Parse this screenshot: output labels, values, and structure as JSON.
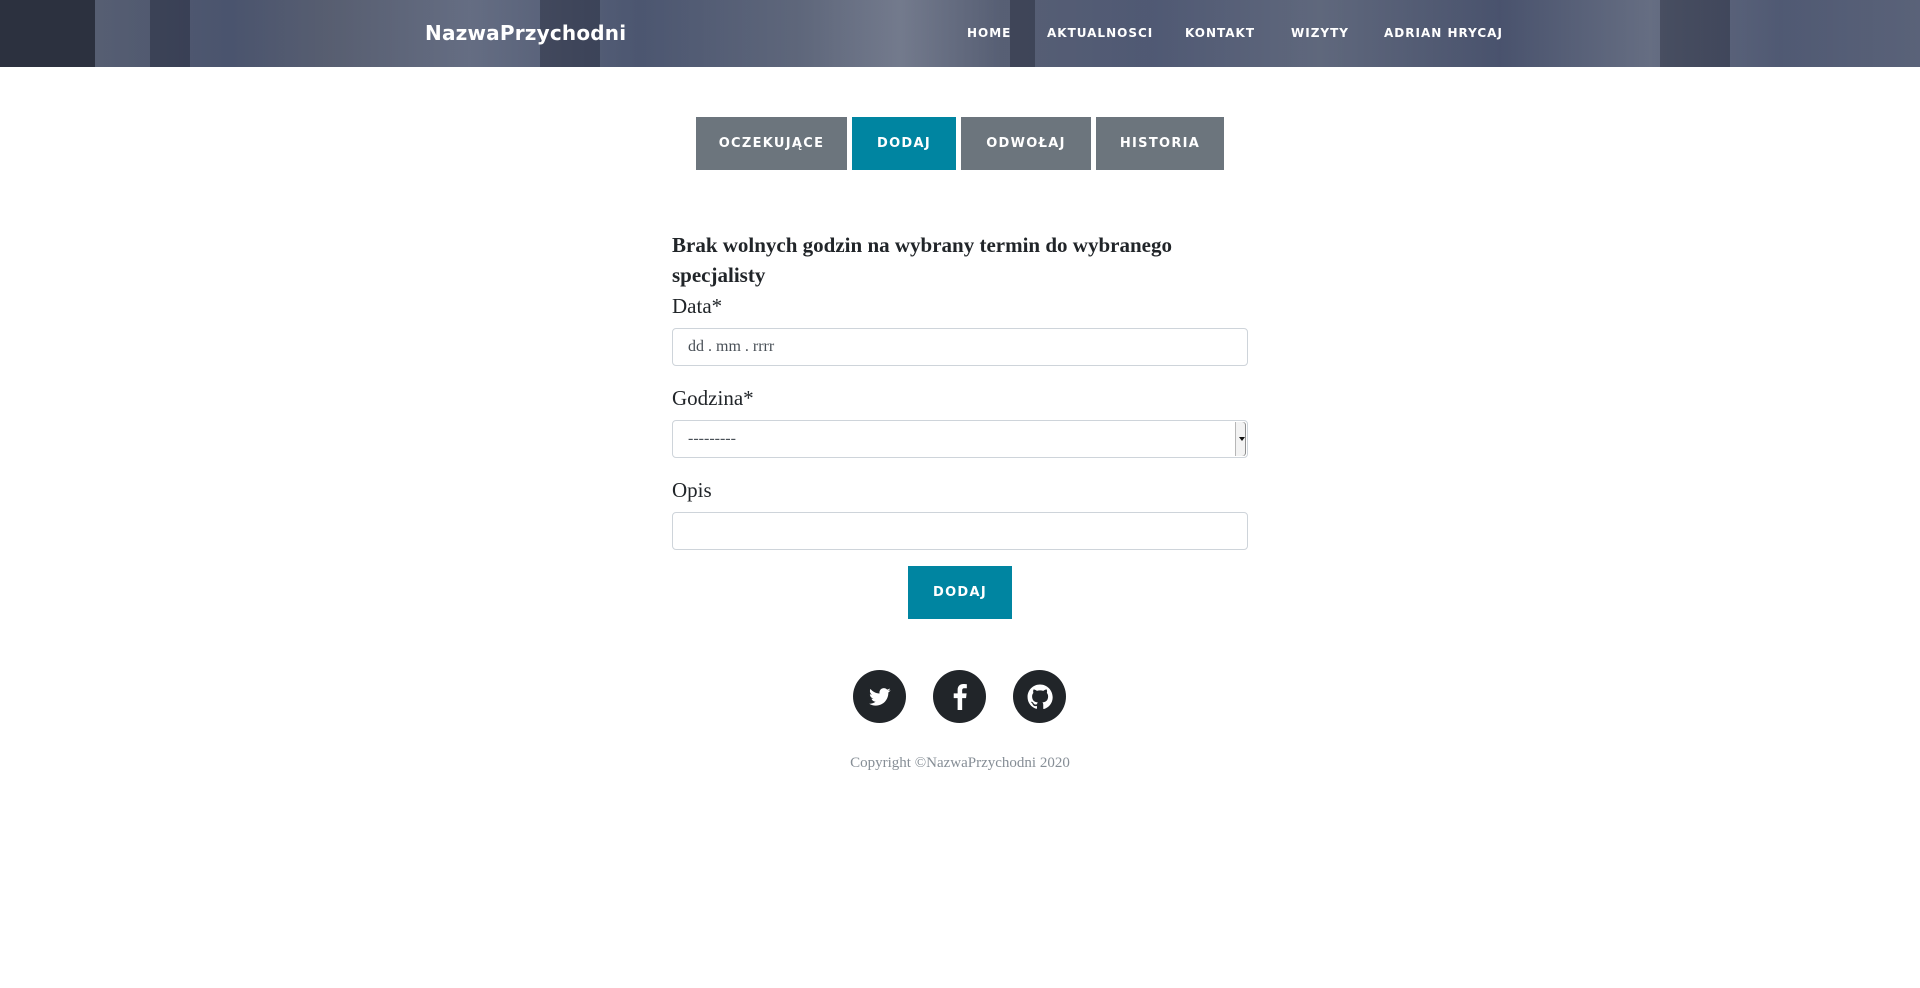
{
  "header": {
    "brand": "NazwaPrzychodni",
    "nav": [
      "HOME",
      "AKTUALNOSCI",
      "KONTAKT",
      "WIZYTY",
      "ADRIAN HRYCAJ"
    ]
  },
  "tabs": [
    {
      "label": "OCZEKUJĄCE",
      "active": false
    },
    {
      "label": "DODAJ",
      "active": true
    },
    {
      "label": "ODWOŁAJ",
      "active": false
    },
    {
      "label": "HISTORIA",
      "active": false
    }
  ],
  "form": {
    "message": "Brak wolnych godzin na wybrany termin do wybranego specjalisty",
    "date_label": "Data*",
    "date_placeholder": "dd . mm . rrrr",
    "hour_label": "Godzina*",
    "hour_selected": "---------",
    "description_label": "Opis",
    "description_value": "",
    "submit_label": "DODAJ"
  },
  "footer": {
    "social_icons": [
      "twitter-icon",
      "facebook-icon",
      "github-icon"
    ],
    "copyright": "Copyright ©NazwaPrzychodni 2020"
  },
  "colors": {
    "accent": "#0085a1",
    "tab_inactive": "#6c757d",
    "social_bg": "#212529",
    "muted_text": "#868e96"
  }
}
